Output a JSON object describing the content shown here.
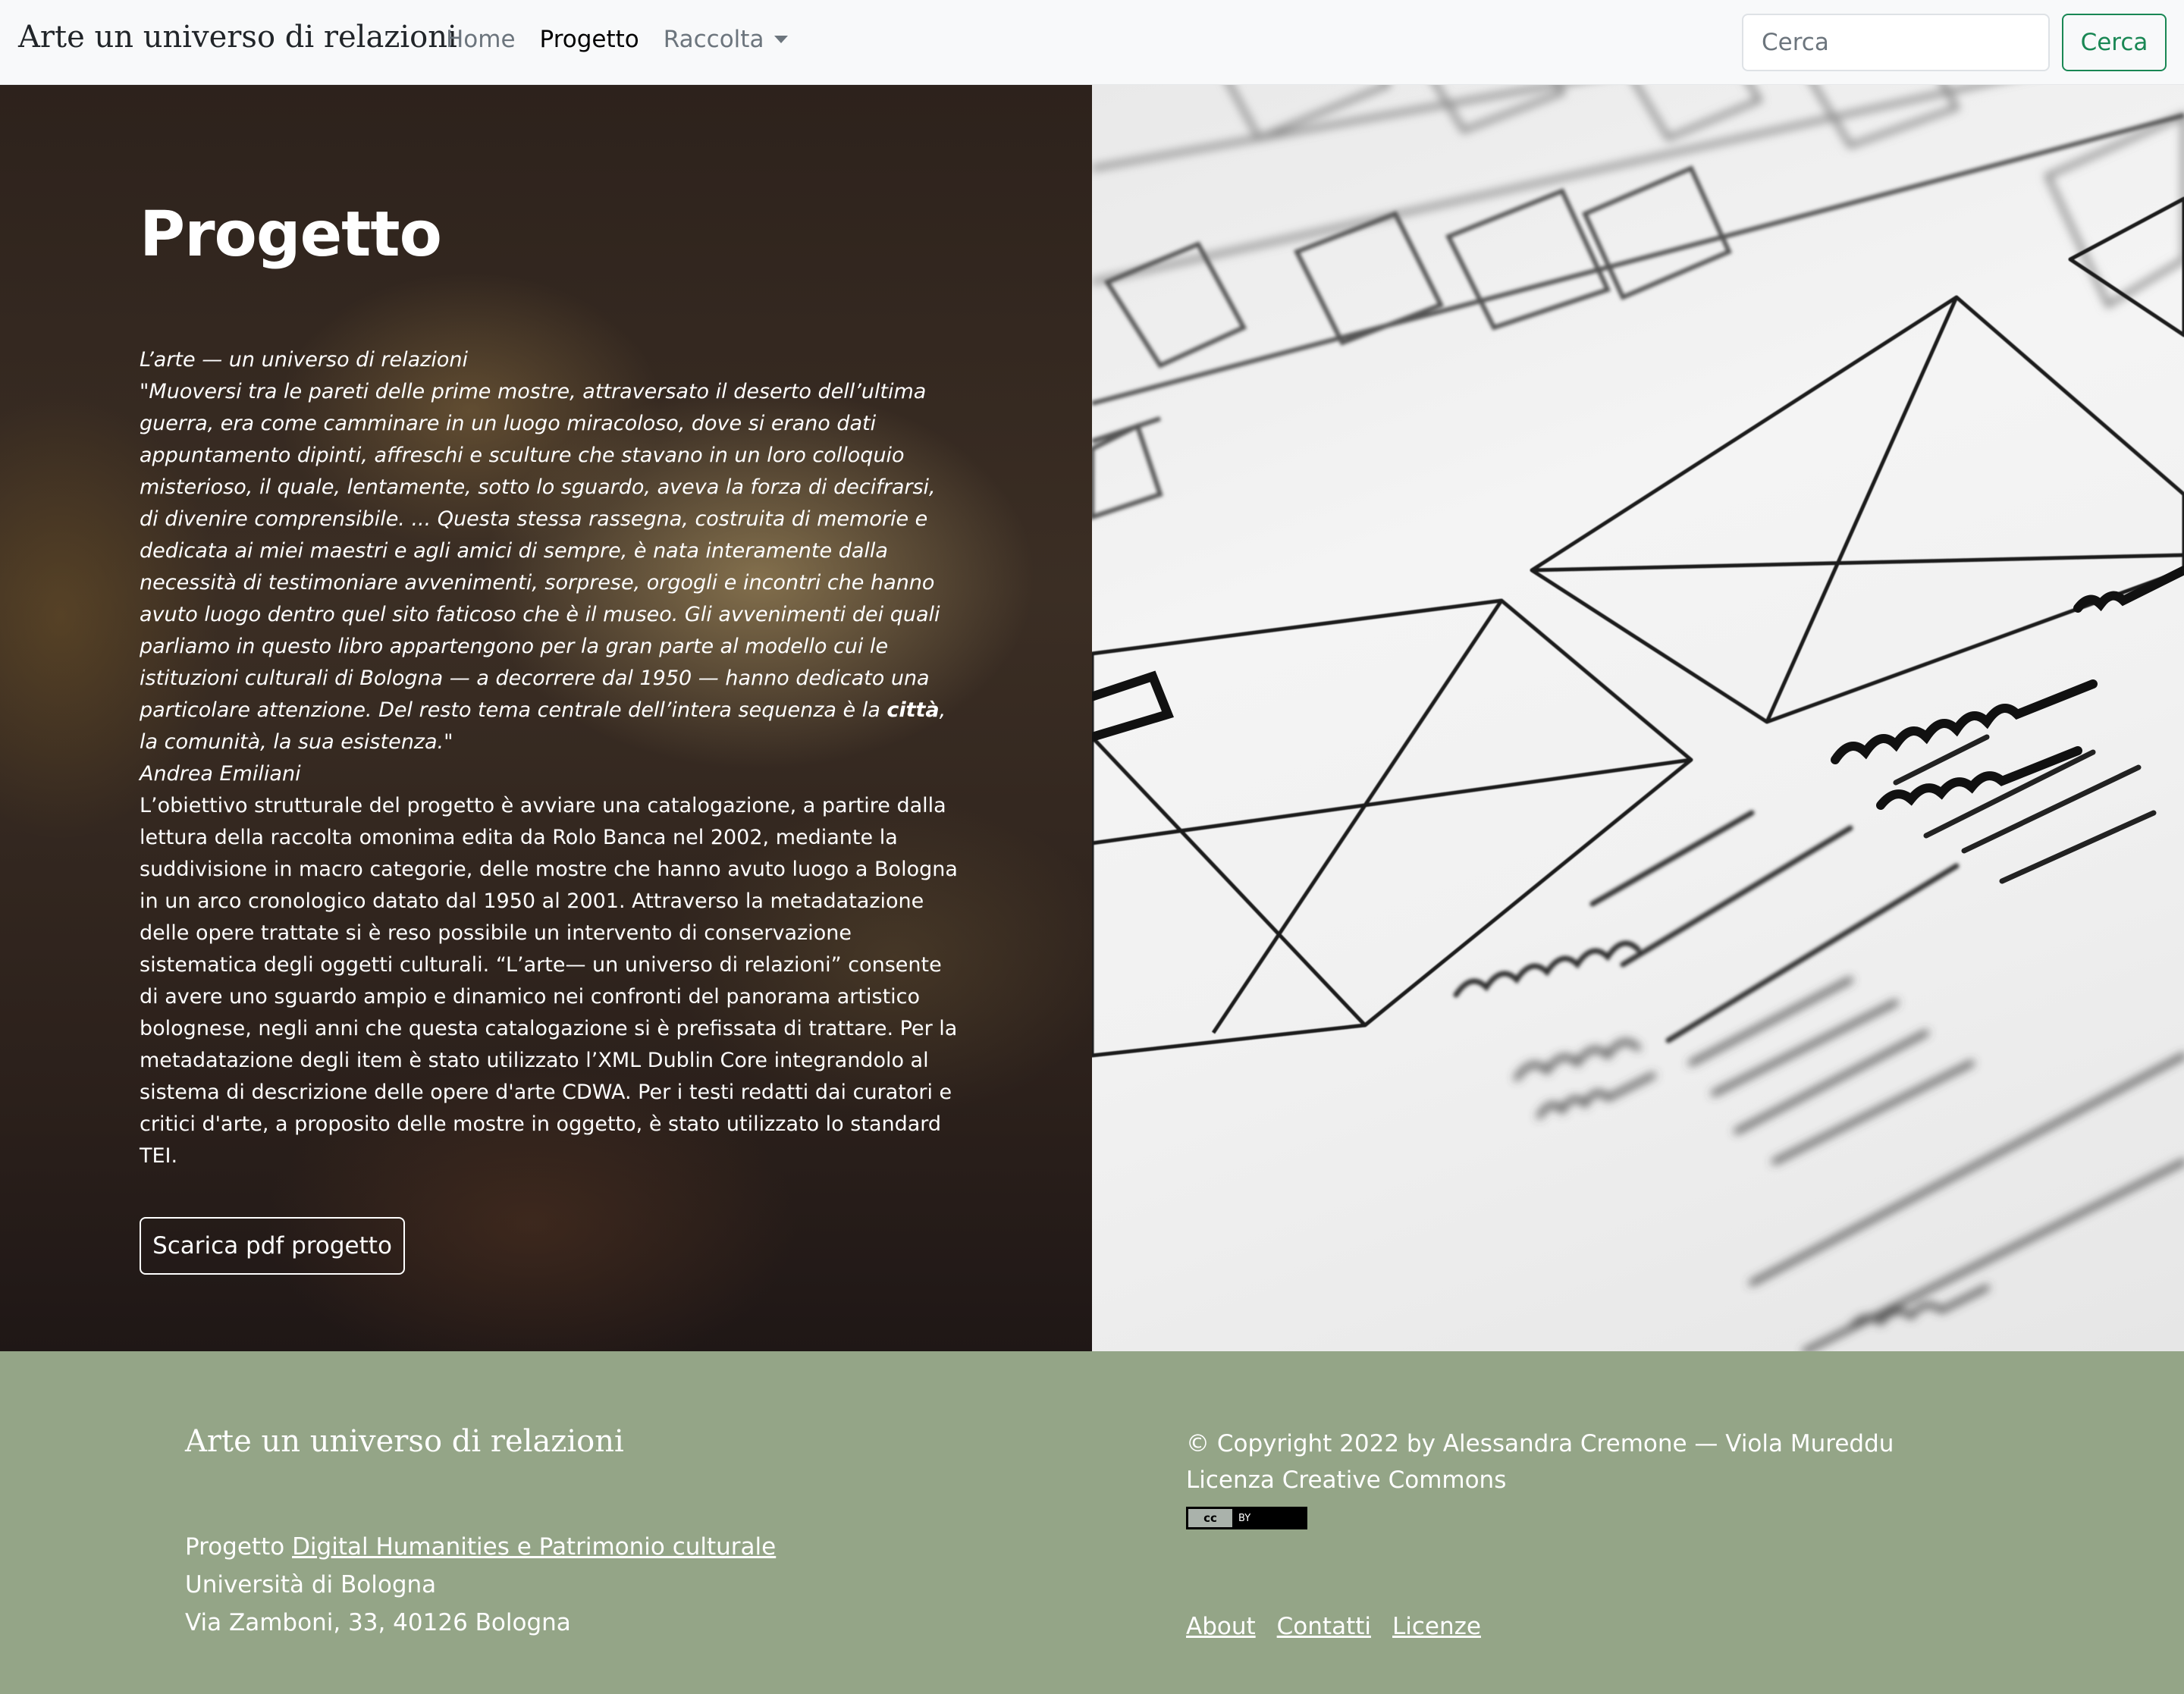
{
  "navbar": {
    "brand": "Arte un universo di relazioni",
    "links": [
      {
        "label": "Home"
      },
      {
        "label": "Progetto"
      },
      {
        "label": "Raccolta"
      }
    ],
    "search_placeholder": "Cerca",
    "search_button": "Cerca"
  },
  "hero": {
    "title": "Progetto",
    "quote_title": "L’arte — un universo di relazioni",
    "quote_before_bold": "\"Muoversi tra le pareti delle prime mostre, attraversato il deserto dell’ultima guerra, era come camminare in un luogo miracoloso, dove si erano dati appuntamento dipinti, affreschi e sculture che stavano in un loro colloquio misterioso, il quale, lentamente, sotto lo sguardo, aveva la forza di decifrarsi, di divenire comprensibile. ... Questa stessa rassegna, costruita di memorie e dedicata ai miei maestri e agli amici di sempre, è nata interamente dalla necessità di testimoniare avvenimenti, sorprese, orgogli e incontri che hanno avuto luogo dentro quel sito faticoso che è il museo. Gli avvenimenti dei quali parliamo in questo libro appartengono per la gran parte al modello cui le istituzioni culturali di Bologna — a decorrere dal 1950 — hanno dedicato una particolare attenzione. Del resto tema centrale dell’intera sequenza è la ",
    "quote_bold": "città",
    "quote_after_bold": ", la comunità, la sua esistenza.\"",
    "quote_author": "Andrea Emiliani",
    "description": "L’obiettivo strutturale del progetto è avviare una catalogazione, a partire dalla lettura della raccolta omonima edita da Rolo Banca nel 2002, mediante la suddivisione in macro categorie, delle mostre che hanno avuto luogo a Bologna in un arco cronologico datato dal 1950 al 2001. Attraverso la metadatazione delle opere trattate si è reso possibile un intervento di conservazione sistematica degli oggetti culturali. “L’arte— un universo di relazioni” consente di avere uno sguardo ampio e dinamico nei confronti del panorama artistico bolognese, negli anni che questa catalogazione si è prefissata di trattare. Per la metadatazione degli item è stato utilizzato l’XML Dublin Core integrandolo al sistema di descrizione delle opere d'arte CDWA. Per i testi redatti dai curatori e critici d'arte, a proposito delle mostre in oggetto, è stato utilizzato lo standard TEI.",
    "download_button": "Scarica pdf progetto"
  },
  "footer": {
    "brand": "Arte un universo di relazioni",
    "project_prefix": "Progetto ",
    "project_link": "Digital Humanities e Patrimonio culturale",
    "university": "Università di Bologna",
    "address": "Via Zamboni, 33, 40126 Bologna",
    "copyright": "© Copyright 2022 by Alessandra Cremone — Viola Mureddu",
    "license": "Licenza Creative Commons",
    "cc_badge_left": "cc",
    "cc_badge_right": "BY",
    "nav": [
      {
        "label": "About"
      },
      {
        "label": "Contatti"
      },
      {
        "label": "Licenze"
      }
    ]
  },
  "colors": {
    "navbar_bg": "#f8f9fa",
    "accent_green": "#198754",
    "footer_bg": "#94a587"
  }
}
